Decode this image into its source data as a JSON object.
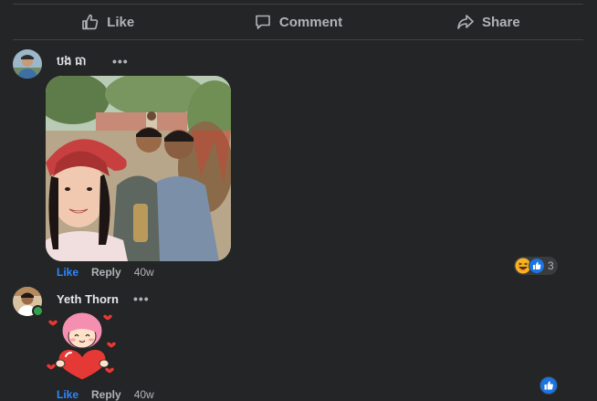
{
  "actions": {
    "like": "Like",
    "comment": "Comment",
    "share": "Share"
  },
  "comments": [
    {
      "author": "បង ធា",
      "more": "•••",
      "like": "Like",
      "reply": "Reply",
      "time": "40w",
      "reaction_count": "3"
    },
    {
      "author": "Yeth Thorn",
      "more": "•••",
      "like": "Like",
      "reply": "Reply",
      "time": "40w"
    }
  ],
  "colors": {
    "background": "#242526",
    "accent": "#2d88ff",
    "muted": "#b0b3b8",
    "online": "#31a24c"
  }
}
